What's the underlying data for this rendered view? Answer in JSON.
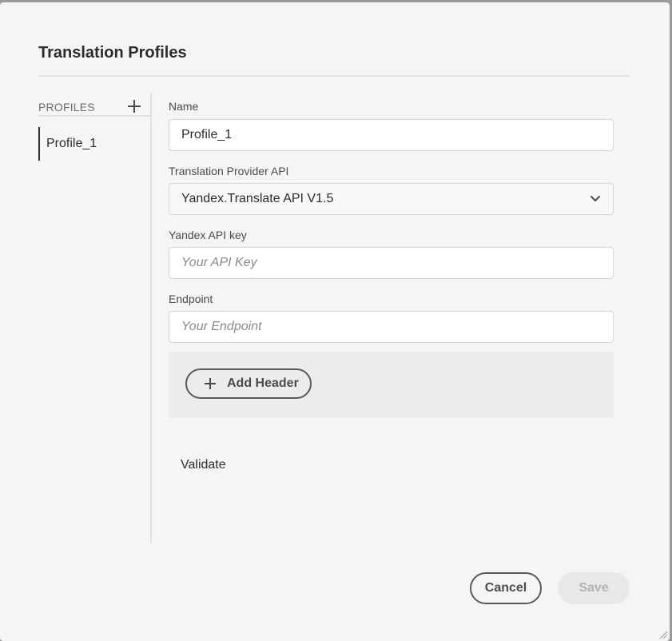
{
  "dialog": {
    "title": "Translation Profiles"
  },
  "sidebar": {
    "header_label": "PROFILES",
    "add_icon": "plus-icon",
    "profiles": [
      {
        "label": "Profile_1",
        "selected": true
      }
    ]
  },
  "form": {
    "name": {
      "label": "Name",
      "value": "Profile_1"
    },
    "provider": {
      "label": "Translation Provider API",
      "selected": "Yandex.Translate API V1.5",
      "icon": "chevron-down-icon"
    },
    "api_key": {
      "label": "Yandex API key",
      "value": "",
      "placeholder": "Your API Key"
    },
    "endpoint": {
      "label": "Endpoint",
      "value": "",
      "placeholder": "Your Endpoint"
    },
    "add_header_label": "Add Header",
    "validate_label": "Validate"
  },
  "footer": {
    "cancel_label": "Cancel",
    "save_label": "Save"
  },
  "colors": {
    "background": "#f5f5f5",
    "text": "#2c2c2c",
    "divider": "#e1e1e1",
    "disabled_text": "#b3b3b3"
  }
}
